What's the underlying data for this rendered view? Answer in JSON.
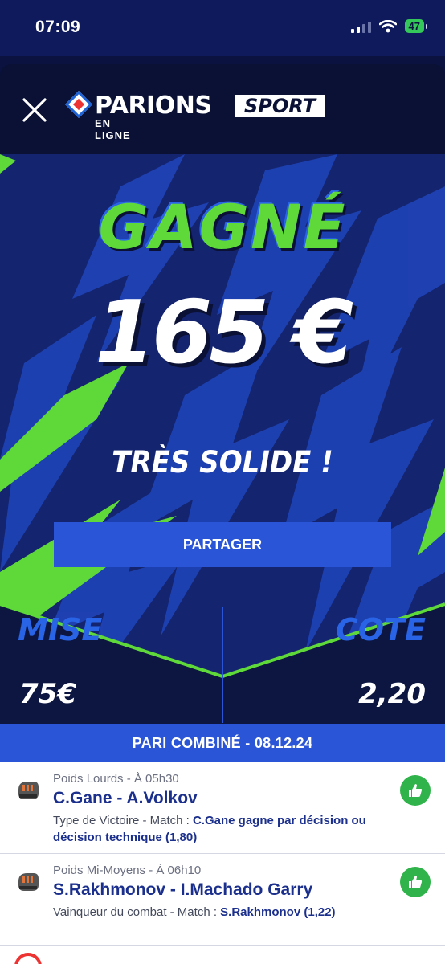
{
  "status_bar": {
    "time": "07:09",
    "battery": "47"
  },
  "header": {
    "brand_main": "PARIONS",
    "brand_sport": "SPORT",
    "brand_sub": "EN LIGNE"
  },
  "hero": {
    "result": "GAGNÉ",
    "amount": "165 €",
    "tagline": "TRÈS SOLIDE !",
    "share_label": "PARTAGER"
  },
  "stats": {
    "mise_label": "MISE",
    "mise_value": "75€",
    "cote_label": "COTE",
    "cote_value": "2,20"
  },
  "bet_header": "PARI COMBINÉ - 08.12.24",
  "bets": [
    {
      "meta": "Poids Lourds - À 05h30",
      "match": "C.Gane - A.Volkov",
      "market": "Type de Victoire - Match : ",
      "selection": "C.Gane gagne par décision ou décision technique (1,80)"
    },
    {
      "meta": "Poids Mi-Moyens - À 06h10",
      "match": "S.Rakhmonov - I.Machado Garry",
      "market": "Vainqueur du combat - Match : ",
      "selection": "S.Rakhmonov (1,22)"
    }
  ],
  "colors": {
    "accent_green": "#5fd93a",
    "accent_blue": "#2a55d6",
    "win_green": "#2fb34a"
  },
  "icons": [
    "close-icon",
    "wifi-icon",
    "signal-icon",
    "mma-glove-icon",
    "thumbs-up-icon"
  ]
}
